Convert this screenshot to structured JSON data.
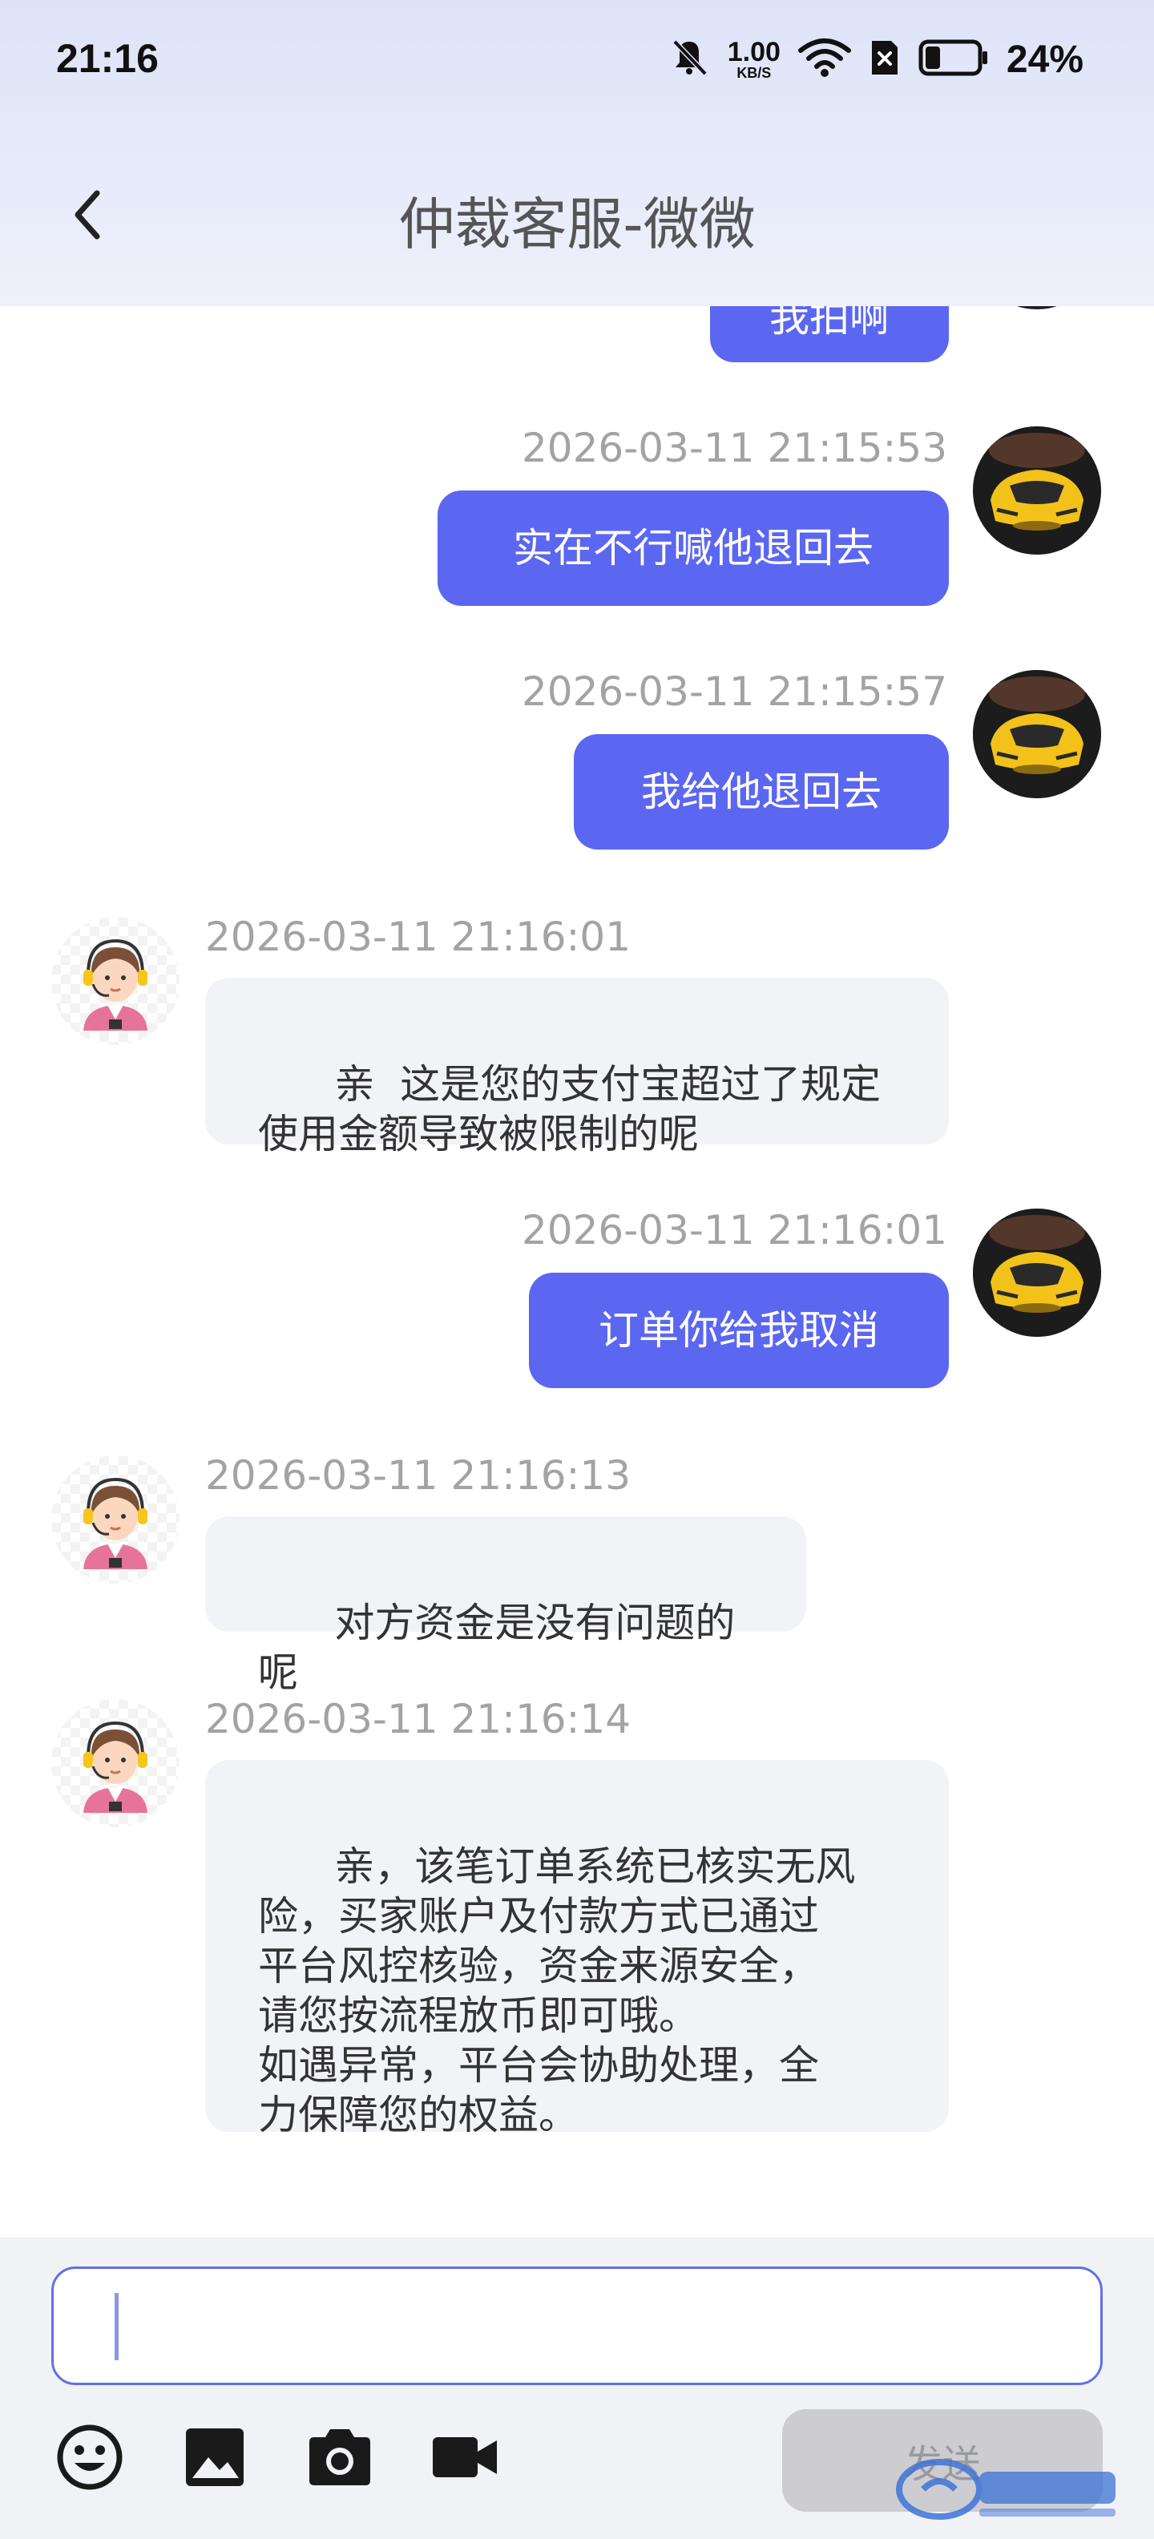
{
  "status_bar": {
    "time": "21:16",
    "net_speed_value": "1.00",
    "net_speed_unit": "KB/S",
    "battery_percent": "24%",
    "icons": [
      "mute-bell-icon",
      "wifi-icon",
      "sim-off-icon",
      "battery-icon"
    ]
  },
  "header": {
    "title": "仲裁客服-微微",
    "back_icon": "chevron-left-icon"
  },
  "messages": [
    {
      "side": "me",
      "text": "我拍啊",
      "timestamp": ""
    },
    {
      "side": "me",
      "text": "实在不行喊他退回去",
      "timestamp": "2026-03-11 21:15:53"
    },
    {
      "side": "me",
      "text": "我给他退回去",
      "timestamp": "2026-03-11 21:15:57"
    },
    {
      "side": "them",
      "text": "亲  这是您的支付宝超过了规定\n使用金额导致被限制的呢",
      "timestamp": "2026-03-11 21:16:01"
    },
    {
      "side": "me",
      "text": "订单你给我取消",
      "timestamp": "2026-03-11 21:16:01"
    },
    {
      "side": "them",
      "text": "对方资金是没有问题的呢",
      "timestamp": "2026-03-11 21:16:13"
    },
    {
      "side": "them",
      "text": "亲，该笔订单系统已核实无风\n险，买家账户及付款方式已通过\n平台风控核验，资金来源安全，\n请您按流程放币即可哦。\n如遇异常，平台会协助处理，全\n力保障您的权益。",
      "timestamp": "2026-03-11 21:16:14"
    }
  ],
  "input": {
    "value": "",
    "placeholder": ""
  },
  "toolbar": {
    "icons": [
      "emoji-icon",
      "image-icon",
      "camera-icon",
      "video-icon"
    ],
    "send_label": "发送"
  },
  "colors": {
    "my_bubble": "#5b67f1",
    "their_bubble": "#f2f3f7",
    "accent_border": "#6270e6",
    "header_gradient_top": "#dde3f7"
  }
}
